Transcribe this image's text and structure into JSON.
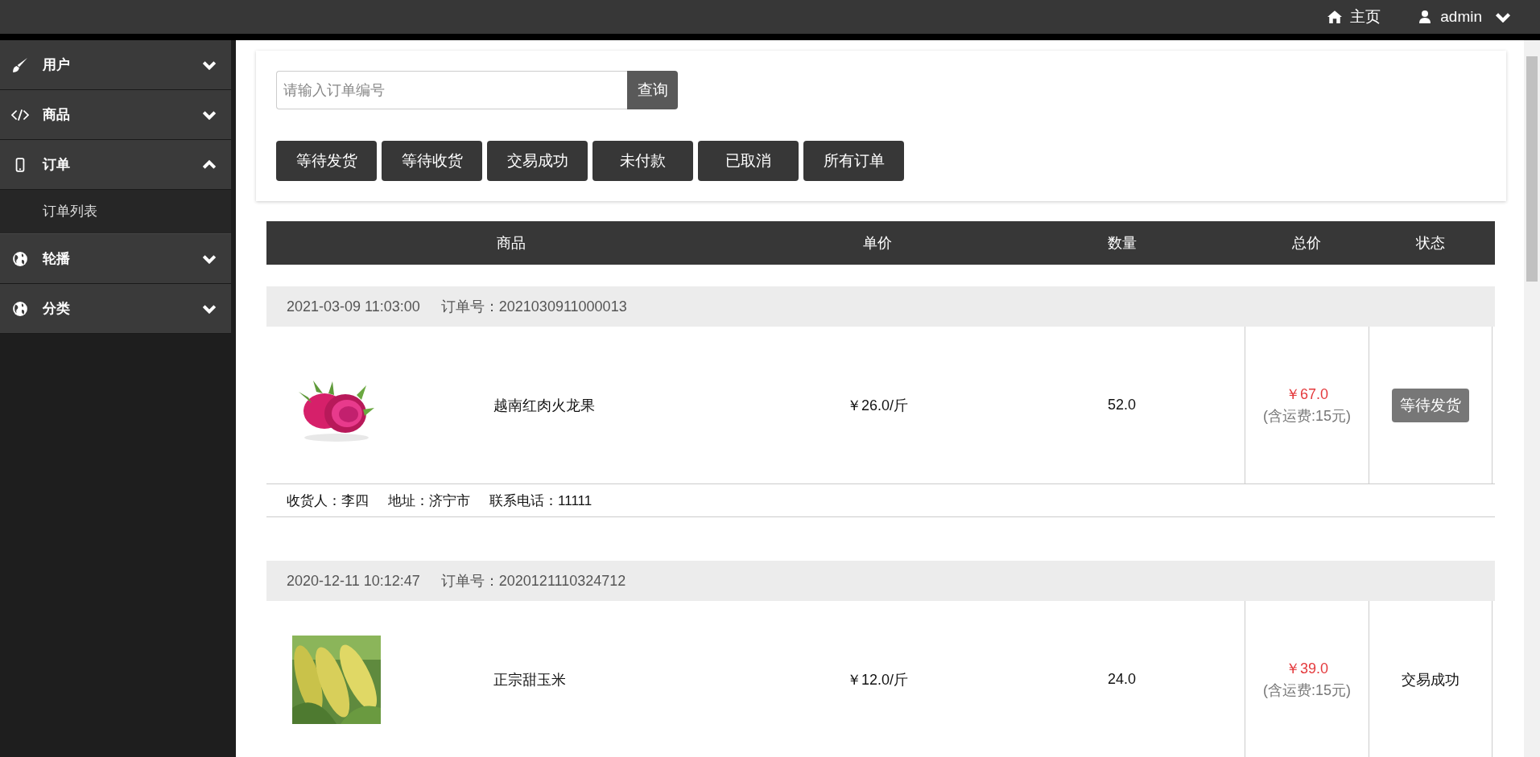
{
  "topbar": {
    "home": "主页",
    "user": "admin"
  },
  "sidebar": {
    "items": [
      {
        "label": "用户",
        "expanded": false
      },
      {
        "label": "商品",
        "expanded": false
      },
      {
        "label": "订单",
        "expanded": true,
        "children": [
          {
            "label": "订单列表"
          }
        ]
      },
      {
        "label": "轮播",
        "expanded": false
      },
      {
        "label": "分类",
        "expanded": false
      }
    ]
  },
  "search": {
    "placeholder": "请输入订单编号",
    "button": "查询"
  },
  "filters": [
    "等待发货",
    "等待收货",
    "交易成功",
    "未付款",
    "已取消",
    "所有订单"
  ],
  "table": {
    "columns": [
      "商品",
      "单价",
      "数量",
      "总价",
      "状态"
    ]
  },
  "orders": [
    {
      "time": "2021-03-09 11:03:00",
      "order_no": "订单号：2021030911000013",
      "product": "越南红肉火龙果",
      "price": "￥26.0/斤",
      "quantity": "52.0",
      "total": "￥67.0",
      "shipping": "(含运费:15元)",
      "status": {
        "text": "等待发货",
        "kind": "button"
      },
      "receiver": "收货人：李四",
      "address": "地址：济宁市",
      "phone": "联系电话：11111"
    },
    {
      "time": "2020-12-11 10:12:47",
      "order_no": "订单号：2020121110324712",
      "product": "正宗甜玉米",
      "price": "￥12.0/斤",
      "quantity": "24.0",
      "total": "￥39.0",
      "shipping": "(含运费:15元)",
      "status": {
        "text": "交易成功",
        "kind": "text"
      }
    }
  ]
}
